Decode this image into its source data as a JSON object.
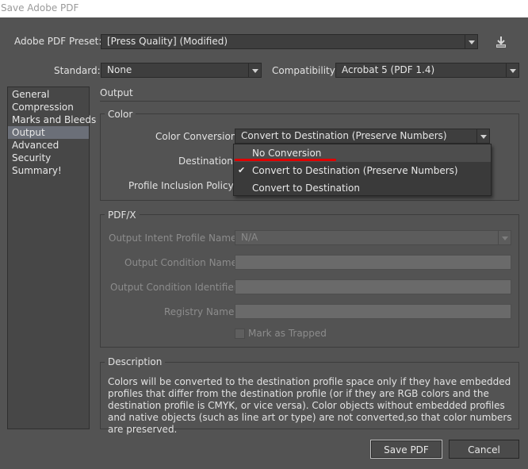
{
  "window": {
    "title": "Save Adobe PDF"
  },
  "preset": {
    "label": "Adobe PDF Preset:",
    "value": "[Press Quality] (Modified)",
    "save_icon": "download-icon"
  },
  "standard": {
    "label": "Standard:",
    "value": "None"
  },
  "compatibility": {
    "label": "Compatibility:",
    "value": "Acrobat 5 (PDF 1.4)"
  },
  "sidebar": {
    "items": [
      "General",
      "Compression",
      "Marks and Bleeds",
      "Output",
      "Advanced",
      "Security",
      "Summary!"
    ],
    "selected": "Output"
  },
  "section_title": "Output",
  "color": {
    "title": "Color",
    "conversion_label": "Color Conversion:",
    "conversion_value": "Convert to Destination (Preserve Numbers)",
    "destination_label": "Destination:",
    "policy_label": "Profile Inclusion Policy:",
    "options": [
      "No Conversion",
      "Convert to Destination (Preserve Numbers)",
      "Convert to Destination"
    ],
    "checked_option": "Convert to Destination (Preserve Numbers)",
    "highlighted_option": "No Conversion"
  },
  "pdfx": {
    "title": "PDF/X",
    "intent_label": "Output Intent Profile Name:",
    "intent_value": "N/A",
    "condition_name_label": "Output Condition Name:",
    "condition_id_label": "Output Condition Identifier:",
    "registry_label": "Registry Name:",
    "trapped_label": "Mark as Trapped"
  },
  "description": {
    "title": "Description",
    "text": "Colors will be converted to the destination profile space only if they have embedded profiles that differ from the destination profile (or if they are RGB colors and the destination profile is CMYK, or vice versa). Color objects without embedded profiles and native objects (such as line art or type) are not converted,so that color numbers are preserved."
  },
  "buttons": {
    "save": "Save PDF",
    "cancel": "Cancel"
  },
  "colors": {
    "background": "#535353",
    "selection": "#6b6f78",
    "annotation": "#e00000"
  }
}
